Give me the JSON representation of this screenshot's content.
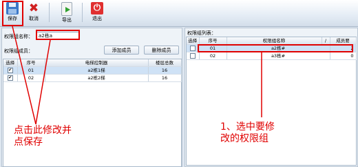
{
  "toolbar": {
    "save_label": "保存",
    "cancel_label": "取消",
    "export_label": "导出",
    "exit_label": "退出"
  },
  "left_panel": {
    "group_name_label": "权限组名称：",
    "group_name_value": "a2栋a",
    "members_label": "权限组成员：",
    "add_member_label": "添加成员",
    "delete_member_label": "删除成员",
    "columns": [
      "选择",
      "序号",
      "电梯控制器",
      "楼层总数"
    ],
    "rows": [
      {
        "checked": true,
        "no": "01",
        "controller": "a2栋1梯",
        "floors": "16"
      },
      {
        "checked": true,
        "no": "02",
        "controller": "a2栋2梯",
        "floors": "16"
      }
    ]
  },
  "right_panel": {
    "list_label": "权限组列表：",
    "columns": [
      "选择",
      "序号",
      "权限组名称",
      "/",
      "成员要"
    ],
    "rows": [
      {
        "checked": false,
        "no": "01",
        "name": "a2栋#",
        "members": "2"
      },
      {
        "checked": false,
        "no": "02",
        "name": "a3栋#",
        "members": "0"
      }
    ]
  },
  "annotations": {
    "left_note": [
      "点击此修改并",
      "点保存"
    ],
    "right_note": [
      "1、选中要修",
      "改的权限组"
    ],
    "color": "#e00000"
  },
  "colors": {
    "selected_row": "#cfe2f6",
    "save_icon": "#3c78c8",
    "cancel_icon": "#d02020",
    "exit_icon": "#e03030"
  }
}
